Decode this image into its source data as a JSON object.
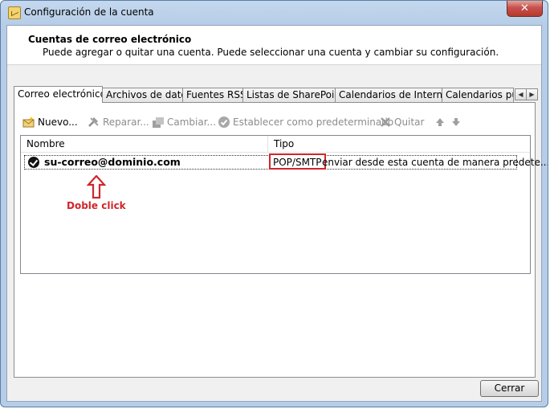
{
  "window": {
    "title": "Configuración de la cuenta",
    "close_glyph": "✕"
  },
  "header": {
    "title": "Cuentas de correo electrónico",
    "description": "Puede agregar o quitar una cuenta. Puede seleccionar una cuenta y cambiar su configuración."
  },
  "tabs": [
    {
      "label": "Correo electrónico",
      "active": true
    },
    {
      "label": "Archivos de datos"
    },
    {
      "label": "Fuentes RSS"
    },
    {
      "label": "Listas de SharePoint"
    },
    {
      "label": "Calendarios de Internet"
    },
    {
      "label": "Calendarios publicados"
    }
  ],
  "tab_scroll": {
    "left": "◀",
    "right": "▶"
  },
  "toolbar": {
    "new": "Nuevo...",
    "repair": "Reparar...",
    "change": "Cambiar...",
    "set_default": "Establecer como predeterminado",
    "remove": "Quitar"
  },
  "list": {
    "columns": {
      "name": "Nombre",
      "type": "Tipo"
    },
    "rows": [
      {
        "name": "su-correo@dominio.com",
        "type": "POP/SMTP",
        "description": "enviar desde esta cuenta de manera predete..."
      }
    ]
  },
  "annotation": {
    "label": "Doble click",
    "color": "#d0262b"
  },
  "footer": {
    "close_label": "Cerrar"
  }
}
